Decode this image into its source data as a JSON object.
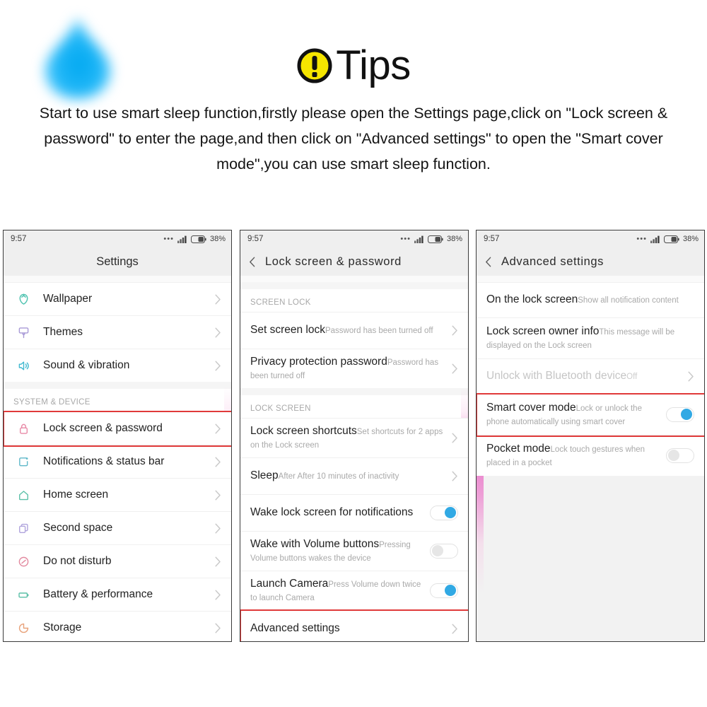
{
  "header": {
    "logo_icon": "water-drop-icon",
    "badge_icon": "exclamation-circle-icon",
    "badge_color": "#f5e500",
    "title": "Tips",
    "paragraph": "Start to use smart sleep function,firstly please open the Settings page,click on \"Lock screen & password\" to enter the page,and then click on \"Advanced settings\" to open the \"Smart cover mode\",you can use smart sleep function."
  },
  "accent": {
    "toggle_on": "#31a9e4",
    "highlight": "#e03a3a",
    "pink_strip": "#e96ac4"
  },
  "status_bar": {
    "time": "9:57",
    "dots_icon": "more-dots-icon",
    "signal_icon": "signal-bars-icon",
    "battery_icon": "battery-icon",
    "battery_pct": "38%"
  },
  "panels": [
    {
      "id": "settings",
      "title": "Settings",
      "has_back": false,
      "rows": [
        {
          "type": "item",
          "icon": "flower-icon",
          "icon_color": "#4fc3b0",
          "label": "Wallpaper",
          "chevron": true
        },
        {
          "type": "item",
          "icon": "brush-icon",
          "icon_color": "#a899d6",
          "label": "Themes",
          "chevron": true
        },
        {
          "type": "item",
          "icon": "speaker-icon",
          "icon_color": "#3fb8cf",
          "label": "Sound & vibration",
          "chevron": true
        },
        {
          "type": "group",
          "label": "SYSTEM & DEVICE"
        },
        {
          "type": "item",
          "icon": "lock-icon",
          "icon_color": "#e889a6",
          "label": "Lock screen & password",
          "chevron": true,
          "highlighted": true
        },
        {
          "type": "item",
          "icon": "notification-icon",
          "icon_color": "#5fb8c9",
          "label": "Notifications & status bar",
          "chevron": true
        },
        {
          "type": "item",
          "icon": "home-icon",
          "icon_color": "#5cc0a8",
          "label": "Home screen",
          "chevron": true
        },
        {
          "type": "item",
          "icon": "second-space-icon",
          "icon_color": "#b0a4dd",
          "label": "Second space",
          "chevron": true
        },
        {
          "type": "item",
          "icon": "do-not-disturb-icon",
          "icon_color": "#e2899f",
          "label": "Do not disturb",
          "chevron": true
        },
        {
          "type": "item",
          "icon": "battery-icon",
          "icon_color": "#5cc0a8",
          "label": "Battery & performance",
          "chevron": true
        },
        {
          "type": "item",
          "icon": "storage-icon",
          "icon_color": "#e8a27a",
          "label": "Storage",
          "chevron": true
        }
      ]
    },
    {
      "id": "lock-screen-password",
      "title": "Lock  screen  &  password",
      "has_back": true,
      "rows": [
        {
          "type": "group",
          "label": "SCREEN LOCK"
        },
        {
          "type": "item",
          "title": "Set screen lock",
          "sub": "Password has been turned off",
          "chevron": true
        },
        {
          "type": "item",
          "title": "Privacy protection password",
          "sub": "Password has been turned off",
          "chevron": true
        },
        {
          "type": "group",
          "label": "LOCK SCREEN"
        },
        {
          "type": "item",
          "title": "Lock screen shortcuts",
          "sub": "Set shortcuts for 2 apps on the Lock screen",
          "chevron": true
        },
        {
          "type": "item",
          "title": "Sleep",
          "sub": "After After 10 minutes of inactivity",
          "chevron": true
        },
        {
          "type": "item",
          "title": "Wake lock screen for notifications",
          "sub": "",
          "toggle": "on"
        },
        {
          "type": "item",
          "title": "Wake with Volume buttons",
          "sub": "Pressing Volume buttons wakes the device",
          "toggle": "off"
        },
        {
          "type": "item",
          "title": "Launch Camera",
          "sub": "Press Volume down twice to launch Camera",
          "toggle": "on"
        },
        {
          "type": "item",
          "title": "Advanced settings",
          "sub": "",
          "chevron": true,
          "highlighted": true
        }
      ]
    },
    {
      "id": "advanced-settings",
      "title": "Advanced  settings",
      "has_back": true,
      "rows": [
        {
          "type": "item",
          "title": "On the lock screen",
          "sub": "Show all notification content"
        },
        {
          "type": "item",
          "title": "Lock screen owner info",
          "sub": "This message will be displayed on the Lock screen"
        },
        {
          "type": "item",
          "title": "Unlock with Bluetooth device",
          "sub": "Off",
          "chevron": true,
          "dim": true
        },
        {
          "type": "item",
          "title": "Smart cover mode",
          "sub": "Lock or unlock the phone automatically using smart cover",
          "toggle": "on",
          "highlighted": true
        },
        {
          "type": "item",
          "title": "Pocket mode",
          "sub": "Lock touch gestures when placed in a pocket",
          "toggle": "off"
        }
      ]
    }
  ]
}
